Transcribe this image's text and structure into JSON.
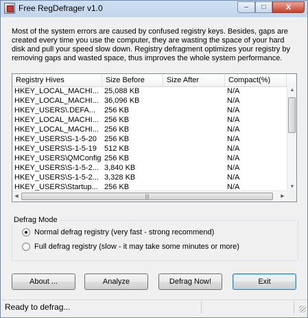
{
  "window": {
    "title": "Free RegDefrager v1.0"
  },
  "titlebar": {
    "minimize_glyph": "–",
    "maximize_glyph": "□",
    "close_glyph": "X"
  },
  "intro": {
    "text": "Most of the system errors are caused by confused registry keys. Besides, gaps are created every time you use the computer, they are wasting the space of your hard disk and pull your speed slow down. Registry defragment optimizes your registry by removing gaps and wasted space, thus improves the whole system performance."
  },
  "hives_table": {
    "columns": [
      "Registry Hives",
      "Size Before",
      "Size After",
      "Compact(%)"
    ],
    "rows": [
      {
        "hive": "HKEY_LOCAL_MACHI...",
        "before": "25,088 KB",
        "after": "",
        "compact": "N/A"
      },
      {
        "hive": "HKEY_LOCAL_MACHI...",
        "before": "36,096 KB",
        "after": "",
        "compact": "N/A"
      },
      {
        "hive": "HKEY_USERS\\.DEFA...",
        "before": "256 KB",
        "after": "",
        "compact": "N/A"
      },
      {
        "hive": "HKEY_LOCAL_MACHI...",
        "before": "256 KB",
        "after": "",
        "compact": "N/A"
      },
      {
        "hive": "HKEY_LOCAL_MACHI...",
        "before": "256 KB",
        "after": "",
        "compact": "N/A"
      },
      {
        "hive": "HKEY_USERS\\S-1-5-20",
        "before": "256 KB",
        "after": "",
        "compact": "N/A"
      },
      {
        "hive": "HKEY_USERS\\S-1-5-19",
        "before": "512 KB",
        "after": "",
        "compact": "N/A"
      },
      {
        "hive": "HKEY_USERS\\QMConfig",
        "before": "256 KB",
        "after": "",
        "compact": "N/A"
      },
      {
        "hive": "HKEY_USERS\\S-1-5-2...",
        "before": "3,840 KB",
        "after": "",
        "compact": "N/A"
      },
      {
        "hive": "HKEY_USERS\\S-1-5-2...",
        "before": "3,328 KB",
        "after": "",
        "compact": "N/A"
      },
      {
        "hive": "HKEY_USERS\\Startup...",
        "before": "256 KB",
        "after": "",
        "compact": "N/A"
      }
    ]
  },
  "defrag_mode": {
    "label": "Defrag Mode",
    "options": [
      {
        "label": "Normal defrag registry (very fast - strong recommend)",
        "checked": true
      },
      {
        "label": "Full defrag registry (slow - it may take some minutes or more)",
        "checked": false
      }
    ]
  },
  "buttons": {
    "about": "About ...",
    "analyze": "Analyze",
    "defrag": "Defrag Now!",
    "exit": "Exit"
  },
  "status": {
    "text": "Ready to defrag..."
  }
}
